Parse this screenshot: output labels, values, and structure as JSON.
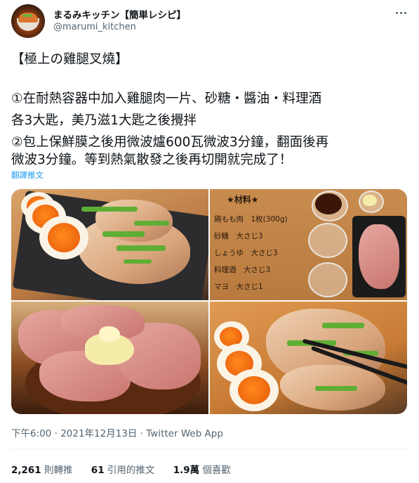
{
  "author": {
    "display_name": "まるみキッチン【簡単レシピ】",
    "handle": "@marumi_kitchen"
  },
  "tweet": {
    "lines": [
      "【極上の雞腿叉燒】",
      "①在耐熱容器中加入雞腿肉一片、砂糖・醬油・料理酒",
      "各3大匙，美乃滋1大匙之後攪拌",
      "②包上保鮮膜之後用微波爐600瓦微波3分鐘，翻面後再",
      "微波3分鐘。等到熱氣散發之後再切開就完成了！"
    ],
    "translate_label": "翻譯推文"
  },
  "recipe_card": {
    "title": "★材料★",
    "rows": [
      "鶏もも肉　1枚(300g)",
      "砂糖　大さじ3",
      "しょうゆ　大さじ3",
      "料理酒　大さじ3",
      "マヨ　大さじ1"
    ]
  },
  "meta": {
    "time": "下午6:00",
    "separator": " · ",
    "date": "2021年12月13日",
    "source": "Twitter Web App"
  },
  "stats": {
    "retweets_count": "2,261",
    "retweets_label": "則轉推",
    "quotes_count": "61",
    "quotes_label": "引用的推文",
    "likes_count": "1.9萬",
    "likes_label": "個喜歡"
  },
  "icons": {
    "more": "more-dots-icon"
  }
}
